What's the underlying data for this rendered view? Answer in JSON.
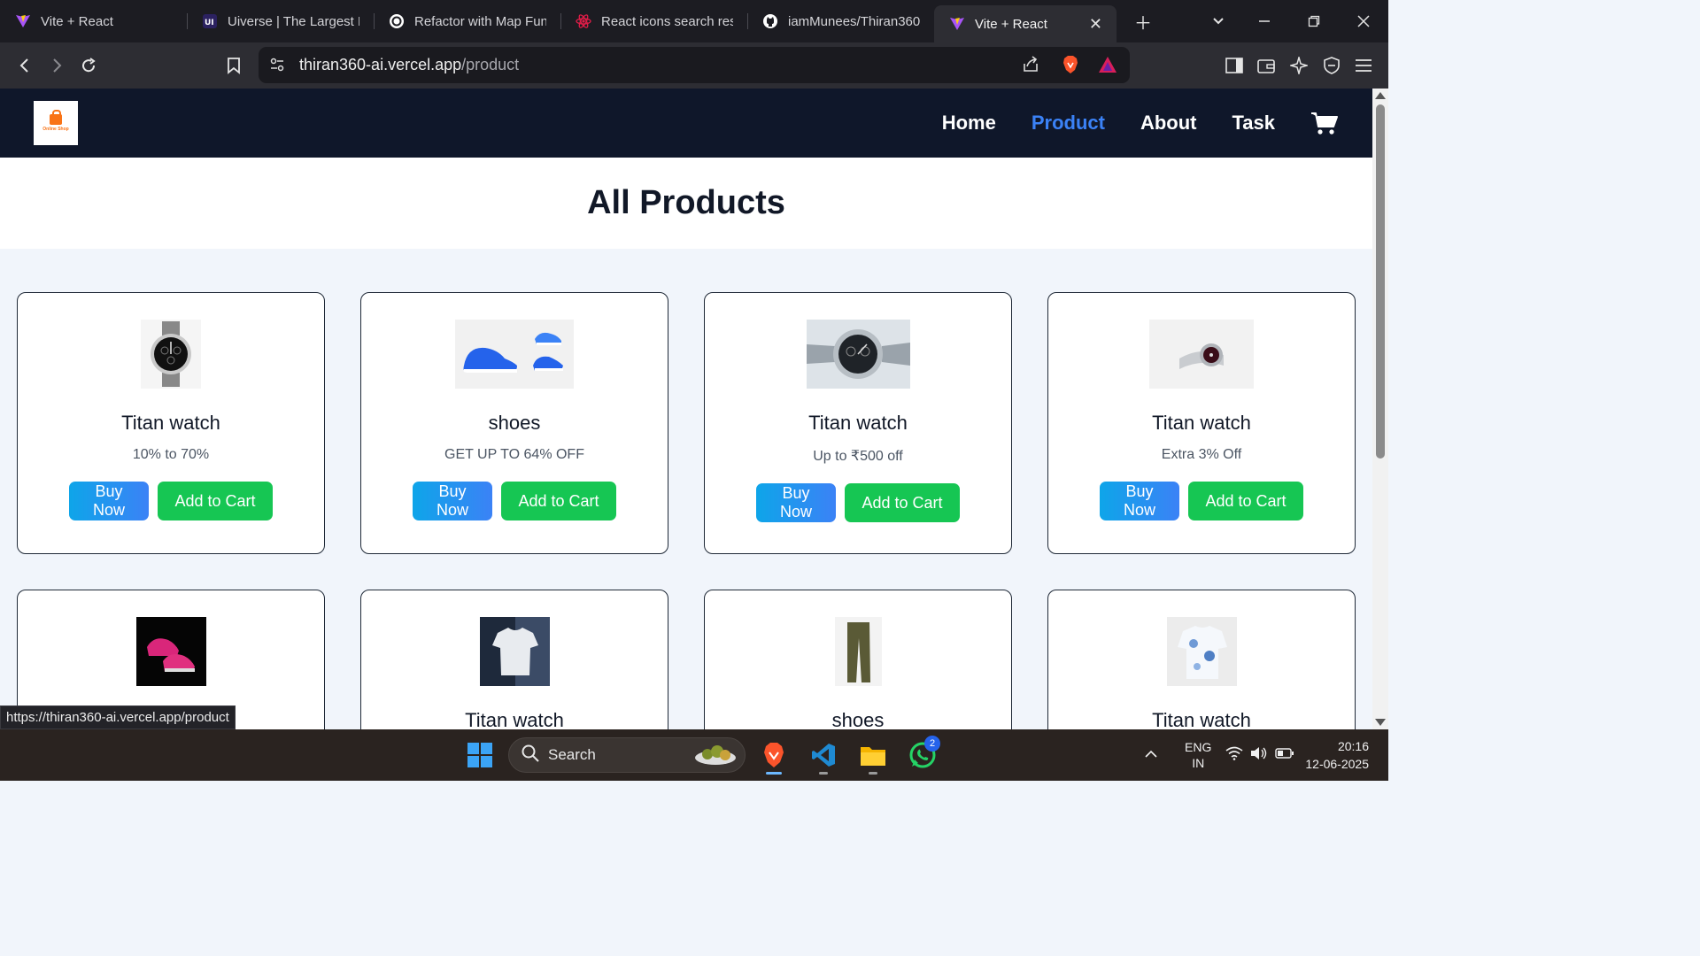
{
  "browser": {
    "tabs": [
      {
        "title": "Vite + React",
        "icon": "vite-icon",
        "active": false
      },
      {
        "title": "Uiverse | The Largest Li",
        "icon": "uiverse-icon",
        "active": false
      },
      {
        "title": "Refactor with Map Func",
        "icon": "chatgpt-icon",
        "active": false
      },
      {
        "title": "React icons search resu",
        "icon": "react-icon",
        "active": false
      },
      {
        "title": "iamMunees/Thiran360",
        "icon": "github-icon",
        "active": false
      },
      {
        "title": "Vite + React",
        "icon": "vite-icon",
        "active": true
      }
    ],
    "url_host": "thiran360-ai.vercel.app",
    "url_path": "/product",
    "status_url": "https://thiran360-ai.vercel.app/product"
  },
  "site": {
    "logo_text": "Online Shop",
    "nav": [
      {
        "label": "Home",
        "active": false
      },
      {
        "label": "Product",
        "active": true
      },
      {
        "label": "About",
        "active": false
      },
      {
        "label": "Task",
        "active": false
      }
    ],
    "heading": "All Products",
    "buy_label": "Buy Now",
    "cart_label": "Add to Cart",
    "products": [
      {
        "title": "Titan watch",
        "subtitle": "10% to 70%",
        "image": "black-chronograph-watch"
      },
      {
        "title": "shoes",
        "subtitle": "GET UP TO 64% OFF",
        "image": "blue-sneakers"
      },
      {
        "title": "Titan watch",
        "subtitle": "Up to ₹500 off",
        "image": "steel-chronograph-watch"
      },
      {
        "title": "Titan watch",
        "subtitle": "Extra 3% Off",
        "image": "silver-watch"
      },
      {
        "title": "",
        "subtitle": "",
        "image": "pink-sneakers"
      },
      {
        "title": "Titan watch",
        "subtitle": "",
        "image": "white-tshirt"
      },
      {
        "title": "shoes",
        "subtitle": "",
        "image": "olive-trousers"
      },
      {
        "title": "Titan watch",
        "subtitle": "",
        "image": "floral-shirt"
      }
    ]
  },
  "taskbar": {
    "search_placeholder": "Search",
    "whatsapp_badge": "2",
    "lang_line1": "ENG",
    "lang_line2": "IN",
    "time": "20:16",
    "date": "12-06-2025"
  },
  "colors": {
    "header_bg": "#0f172a",
    "nav_active": "#3b82f6",
    "buy_button": "#0ea5e9",
    "cart_button": "#16c653"
  }
}
